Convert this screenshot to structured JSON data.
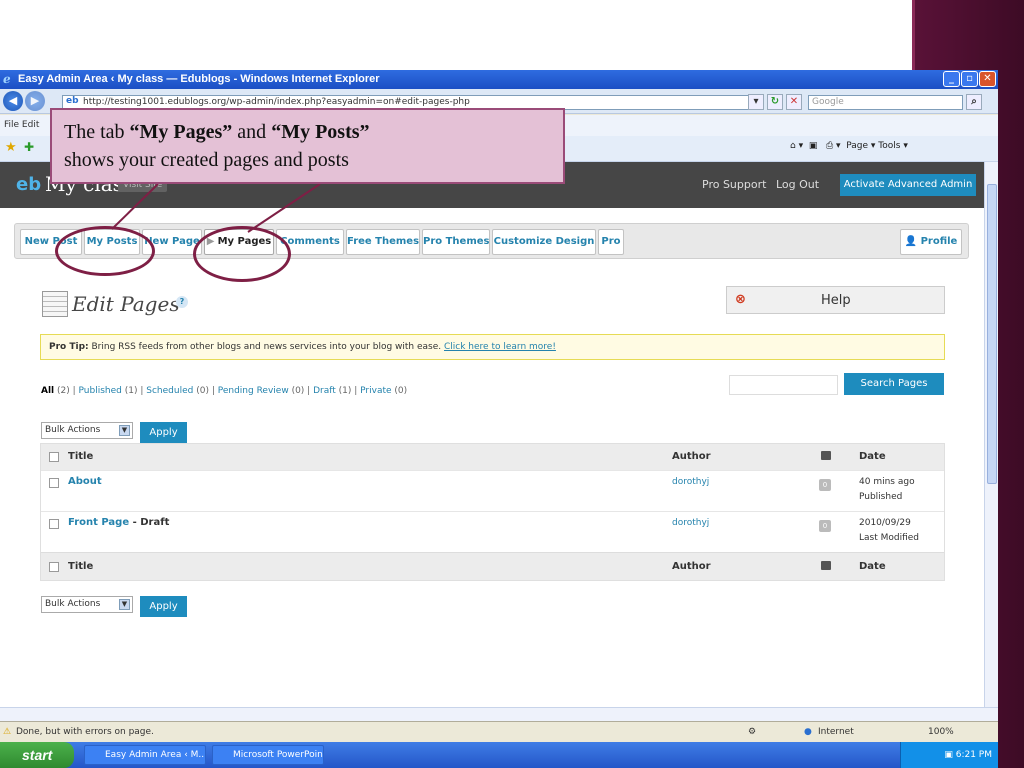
{
  "window": {
    "title": "Easy Admin Area ‹ My class — Edublogs - Windows Internet Explorer",
    "address": "http://testing1001.edublogs.org/wp-admin/index.php?easyadmin=on#edit-pages-php",
    "search_placeholder": "Google",
    "menu": "File  Edit",
    "command_bar": "Page ▾  Tools ▾",
    "status": "Done, but with errors on page.",
    "zone": "Internet",
    "zoom": "100%"
  },
  "wp_header": {
    "site_title": "My class",
    "visit_site": "Visit Site",
    "pro_support": "Pro Support",
    "log_out": "Log Out",
    "activate": "Activate Advanced Admin"
  },
  "tabs": [
    {
      "label": "New Post"
    },
    {
      "label": "My Posts"
    },
    {
      "label": "New Page"
    },
    {
      "label": "My Pages"
    },
    {
      "label": "Comments"
    },
    {
      "label": "Free Themes"
    },
    {
      "label": "Pro Themes"
    },
    {
      "label": "Customize Design"
    },
    {
      "label": "Pro"
    }
  ],
  "profile_tab": "Profile",
  "page": {
    "heading": "Edit Pages",
    "help_label": "Help",
    "pro_tip_label": "Pro Tip:",
    "pro_tip_text": " Bring RSS feeds from other blogs and news services into your blog with ease. ",
    "pro_tip_link": "Click here to learn more!",
    "filters": {
      "all": "All",
      "all_count": "(2)",
      "published": "Published",
      "published_count": "(1)",
      "scheduled": "Scheduled",
      "scheduled_count": "(0)",
      "pending": "Pending Review",
      "pending_count": "(0)",
      "draft": "Draft",
      "draft_count": "(1)",
      "private": "Private",
      "private_count": "(0)"
    },
    "search_button": "Search Pages",
    "bulk_actions": "Bulk Actions",
    "apply": "Apply"
  },
  "table": {
    "headers": {
      "title": "Title",
      "author": "Author",
      "date": "Date"
    },
    "rows": [
      {
        "title": "About",
        "suffix": "",
        "author": "dorothyj",
        "comments": "0",
        "date": "40 mins ago",
        "status": "Published"
      },
      {
        "title": "Front Page",
        "suffix": " - Draft",
        "author": "dorothyj",
        "comments": "0",
        "date": "2010/09/29",
        "status": "Last Modified"
      }
    ]
  },
  "taskbar": {
    "start": "start",
    "items": [
      "Easy Admin Area ‹ M...",
      "Microsoft PowerPoint ..."
    ],
    "clock": "6:21 PM"
  },
  "callout": {
    "line1_pre": "The tab ",
    "line1_b1": "“My Pages”",
    "line1_mid": " and ",
    "line1_b2": "“My Posts”",
    "line2": "shows your  created pages and posts"
  }
}
